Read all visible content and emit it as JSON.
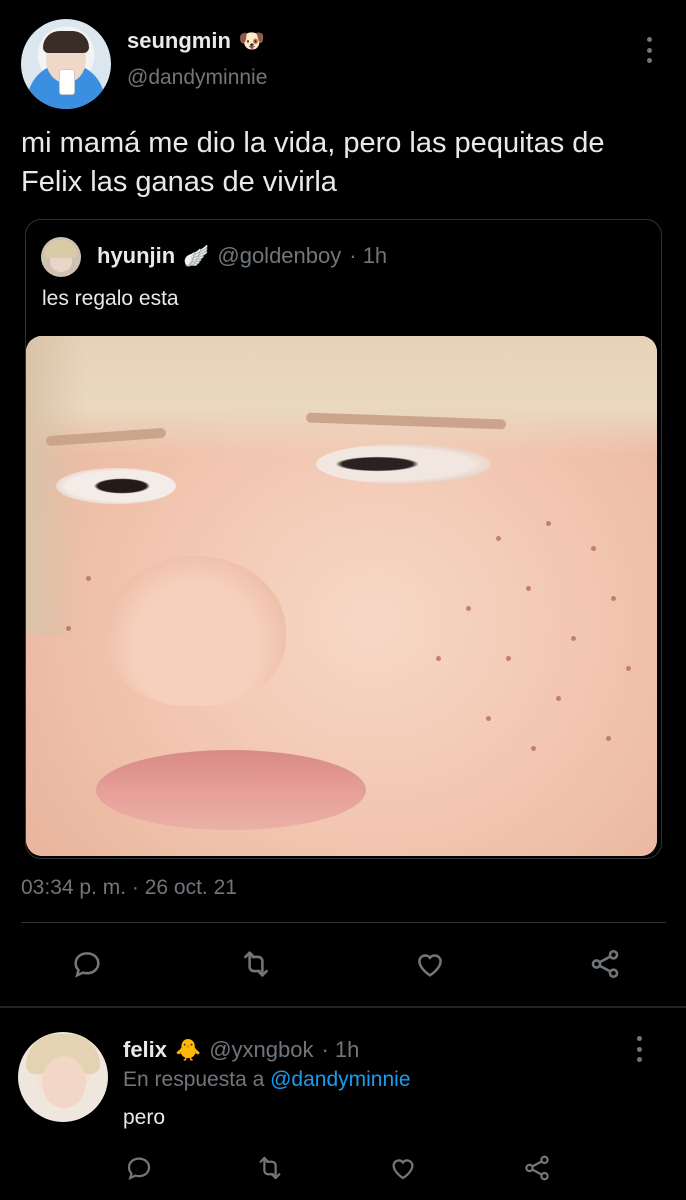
{
  "main_tweet": {
    "author_name": "seungmin",
    "author_emoji": "🐶",
    "handle": "@dandyminnie",
    "text": "mi mamá me dio la vida, pero las pequitas de Felix las ganas de vivirla",
    "timestamp": "03:34 p. m. · 26 oct. 21",
    "quote": {
      "author_name": "hyunjin",
      "author_emoji": "🪽",
      "handle": "@goldenboy",
      "time": "· 1h",
      "text": "les regalo esta"
    },
    "actions": [
      "reply-icon",
      "retweet-icon",
      "like-icon",
      "share-icon"
    ]
  },
  "reply_tweet": {
    "author_name": "felix",
    "author_emoji": "🐥",
    "handle": "@yxngbok",
    "time": "· 1h",
    "replying_prefix": "En respuesta a",
    "replying_to": "@dandyminnie",
    "text": "pero",
    "actions": [
      "reply-icon",
      "retweet-icon",
      "like-icon",
      "share-icon"
    ]
  },
  "colors": {
    "background": "#000000",
    "text": "#e7e9ea",
    "muted": "#71767b",
    "link": "#1d9bf0",
    "border": "#2f3336"
  }
}
